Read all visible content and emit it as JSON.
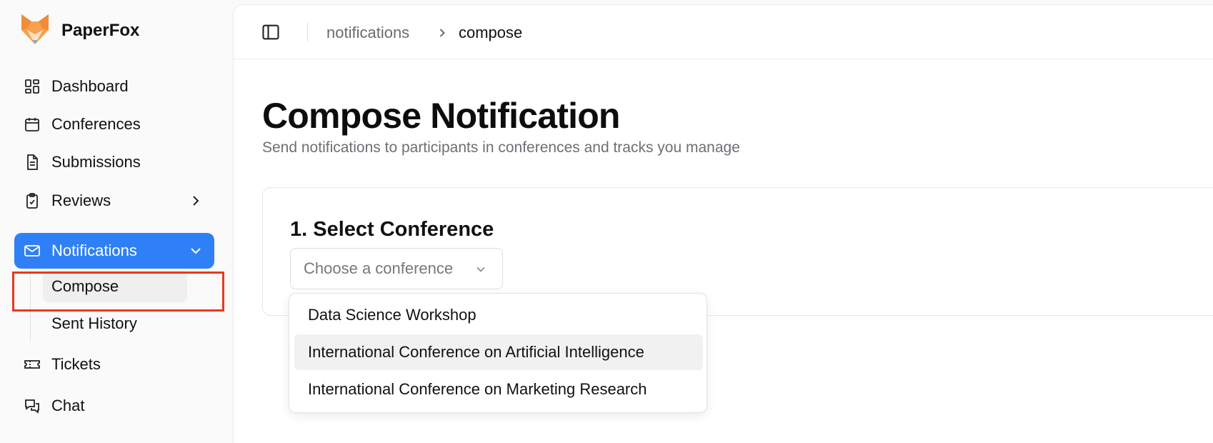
{
  "app": {
    "name": "PaperFox"
  },
  "sidebar": {
    "items": [
      {
        "label": "Dashboard",
        "icon": "dashboard-icon"
      },
      {
        "label": "Conferences",
        "icon": "calendar-icon"
      },
      {
        "label": "Submissions",
        "icon": "document-icon"
      },
      {
        "label": "Reviews",
        "icon": "clipboard-check-icon"
      },
      {
        "label": "Notifications",
        "icon": "mail-icon"
      },
      {
        "label": "Tickets",
        "icon": "ticket-icon"
      },
      {
        "label": "Chat",
        "icon": "chat-icon"
      }
    ],
    "notifications_sub": [
      {
        "label": "Compose"
      },
      {
        "label": "Sent History"
      }
    ]
  },
  "breadcrumb": {
    "parent": "notifications",
    "current": "compose"
  },
  "page": {
    "title": "Compose Notification",
    "subtitle": "Send notifications to participants in conferences and tracks you manage"
  },
  "form": {
    "section_title": "1. Select Conference",
    "select_placeholder": "Choose a conference",
    "options": [
      "Data Science Workshop",
      "International Conference on Artificial Intelligence",
      "International Conference on Marketing Research"
    ]
  },
  "colors": {
    "accent": "#2f80f6",
    "highlight": "#e8381f",
    "brand_orange": "#f5a04c"
  }
}
